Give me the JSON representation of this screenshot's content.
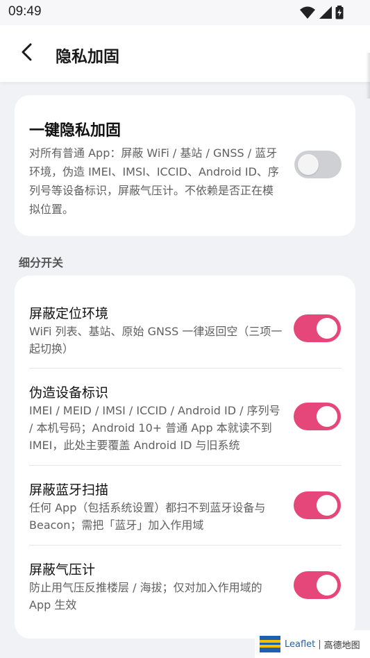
{
  "status_bar": {
    "time": "09:49"
  },
  "app_bar": {
    "title": "隐私加固"
  },
  "one_click": {
    "title": "一键隐私加固",
    "description": "对所有普通 App：屏蔽 WiFi / 基站 / GNSS / 蓝牙环境，伪造 IMEI、IMSI、ICCID、Android ID、序列号等设备标识，屏蔽气压计。不依赖是否正在模拟位置。",
    "enabled": false
  },
  "section": {
    "label": "细分开关"
  },
  "options": [
    {
      "title": "屏蔽定位环境",
      "description": "WiFi 列表、基站、原始 GNSS 一律返回空（三项一起切换）",
      "enabled": true
    },
    {
      "title": "伪造设备标识",
      "description": "IMEI / MEID / IMSI / ICCID / Android ID / 序列号 / 本机号码；Android 10+ 普通 App 本就读不到 IMEI，此处主要覆盖 Android ID 与旧系统",
      "enabled": true
    },
    {
      "title": "屏蔽蓝牙扫描",
      "description": "任何 App（包括系统设置）都扫不到蓝牙设备与 Beacon；需把「蓝牙」加入作用域",
      "enabled": true
    },
    {
      "title": "屏蔽气压计",
      "description": "防止用气压反推楼层 / 海拔；仅对加入作用域的 App 生效",
      "enabled": true
    }
  ],
  "attribution": {
    "leaflet": "Leaflet",
    "separator": "|",
    "provider": "高德地图"
  },
  "colors": {
    "accent": "#e6477a",
    "toggle_off": "#cfd0d4",
    "background": "#f1f2f6",
    "card": "#ffffff"
  },
  "icons": {
    "back": "arrow-left-icon",
    "wifi": "wifi-icon",
    "signal": "signal-icon",
    "battery": "battery-icon"
  }
}
